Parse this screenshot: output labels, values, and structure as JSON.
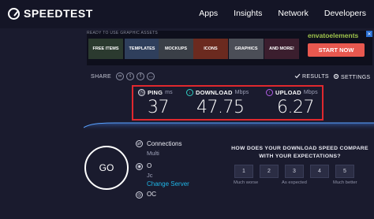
{
  "brand": {
    "name": "SPEEDTEST"
  },
  "nav": {
    "items": [
      "Apps",
      "Insights",
      "Network",
      "Developers"
    ]
  },
  "ad": {
    "caption": "READY TO USE GRAPHIC ASSETS",
    "tiles": [
      {
        "label": "FREE ITEMS",
        "color": "#2b3a2f"
      },
      {
        "label": "TEMPLATES",
        "color": "#2f3f5c"
      },
      {
        "label": "MOCKUPS",
        "color": "#3a3f47"
      },
      {
        "label": "ICONS",
        "color": "#6b2a1f"
      },
      {
        "label": "GRAPHICS",
        "color": "#4b4e57"
      },
      {
        "label": "AND MORE!",
        "color": "#3b1e2e"
      }
    ],
    "advertiser": "envatoelements",
    "cta": "START NOW",
    "close_glyph": "✕"
  },
  "share": {
    "label": "SHARE",
    "icons": [
      "link-icon",
      "twitter-icon",
      "facebook-icon",
      "more-icon"
    ],
    "icon_glyphs": [
      "∞",
      "t",
      "f",
      "…"
    ]
  },
  "links": {
    "results": "RESULTS",
    "settings": "SETTINGS"
  },
  "metrics": {
    "ping": {
      "label": "PING",
      "unit": "ms",
      "value": "37",
      "color": "#e8e9f0"
    },
    "download": {
      "label": "DOWNLOAD",
      "unit": "Mbps",
      "value": "47.75",
      "color": "#2fd1c4"
    },
    "upload": {
      "label": "UPLOAD",
      "unit": "Mbps",
      "value": "6.27",
      "color": "#b35ee8"
    }
  },
  "highlight_color": "#e0282e",
  "test": {
    "go_label": "GO",
    "connections_label": "Connections",
    "connections_value": "Multi",
    "host_line_1": "O",
    "host_line_2": "Jc",
    "change_server": "Change Server",
    "isp_line": "OC"
  },
  "survey": {
    "question": "HOW DOES YOUR DOWNLOAD SPEED COMPARE WITH YOUR EXPECTATIONS?",
    "options": [
      "1",
      "2",
      "3",
      "4",
      "5"
    ],
    "low_caption": "Much worse",
    "mid_caption": "As expected",
    "high_caption": "Much better"
  }
}
